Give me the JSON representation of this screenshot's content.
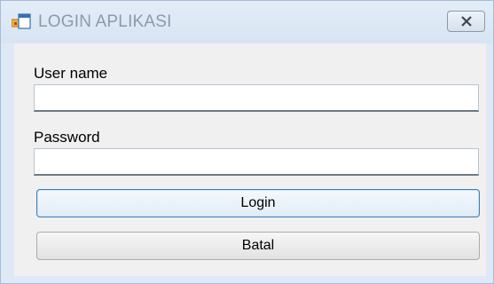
{
  "window": {
    "title": "LOGIN APLIKASI",
    "icon": "app-window-icon",
    "close_icon": "close-icon"
  },
  "form": {
    "username_label": "User name",
    "username_value": "",
    "password_label": "Password",
    "password_value": "",
    "login_label": "Login",
    "cancel_label": "Batal"
  },
  "colors": {
    "title_text": "#8c9aab",
    "frame": "#dfe9f5",
    "client_bg": "#f0f0f0",
    "focus_border": "#3c7fb1"
  }
}
